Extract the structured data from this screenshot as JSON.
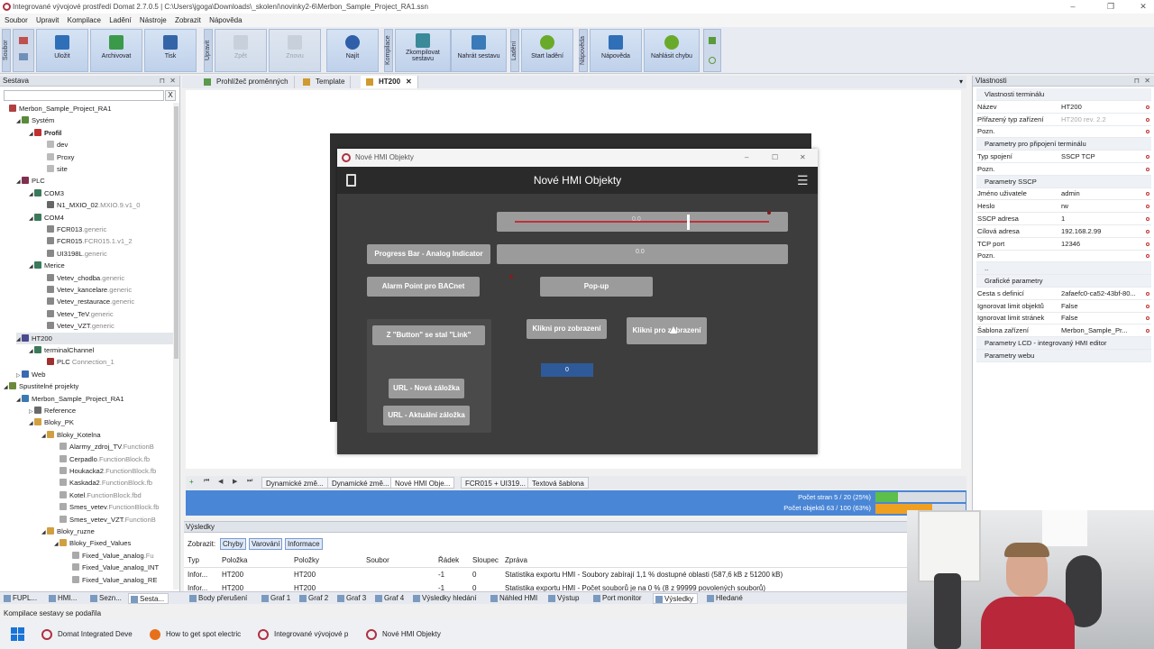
{
  "app": {
    "title": "Integrované vývojové prostředí Domat 2.7.0.5 | C:\\Users\\jgoga\\Downloads\\_skolení\\novinky2-6\\Merbon_Sample_Project_RA1.ssn",
    "menu": [
      "Soubor",
      "Upravit",
      "Kompilace",
      "Ladění",
      "Nástroje",
      "Zobrazit",
      "Nápověda"
    ],
    "window_controls": [
      "–",
      "❐",
      "✕"
    ]
  },
  "ribbon": {
    "groups": [
      "Soubor",
      "Upravit",
      "Kompilace",
      "Ladění",
      "Nápověda"
    ],
    "buttons": [
      "Uložit",
      "Archivovat",
      "Tisk",
      "Zpět",
      "Znovu",
      "Najít",
      "Zkompilovat sestavu",
      "Nahrát sestavu",
      "Start ladění",
      "Nápověda",
      "Nahlásit chybu"
    ]
  },
  "left_panel": {
    "title": "Sestava",
    "search_clear": "X",
    "tree": [
      {
        "text": "Merbon_Sample_Project_RA1",
        "gen": ""
      },
      {
        "text": "Systém",
        "gen": ""
      },
      {
        "text": "Profil",
        "gen": ""
      },
      {
        "text": "dev",
        "gen": ""
      },
      {
        "text": "Proxy",
        "gen": ""
      },
      {
        "text": "site",
        "gen": ""
      },
      {
        "text": "PLC",
        "gen": ""
      },
      {
        "text": "COM3",
        "gen": ""
      },
      {
        "text": "N1_MXIO_02",
        "gen": ".MXIO.9.v1_0"
      },
      {
        "text": "COM4",
        "gen": ""
      },
      {
        "text": "FCR013",
        "gen": ".generic"
      },
      {
        "text": "FCR015",
        "gen": ".FCR015.1.v1_2"
      },
      {
        "text": "UI3198L",
        "gen": ".generic"
      },
      {
        "text": "Merice",
        "gen": ""
      },
      {
        "text": "Vetev_chodba",
        "gen": ".generic"
      },
      {
        "text": "Vetev_kancelare",
        "gen": ".generic"
      },
      {
        "text": "Vetev_restaurace",
        "gen": ".generic"
      },
      {
        "text": "Vetev_TeV",
        "gen": ".generic"
      },
      {
        "text": "Vetev_VZT",
        "gen": ".generic"
      },
      {
        "text": "HT200",
        "gen": ""
      },
      {
        "text": "terminalChannel",
        "gen": ""
      },
      {
        "text": "PLC",
        "gen": " Connection_1"
      },
      {
        "text": "Web",
        "gen": ""
      },
      {
        "text": "Spustitelné projekty",
        "gen": ""
      },
      {
        "text": "Merbon_Sample_Project_RA1",
        "gen": ""
      },
      {
        "text": "Reference",
        "gen": ""
      },
      {
        "text": "Bloky_PK",
        "gen": ""
      },
      {
        "text": "Bloky_Kotelna",
        "gen": ""
      },
      {
        "text": "Alarmy_zdroj_TV",
        "gen": ".FunctionB"
      },
      {
        "text": "Cerpadlo",
        "gen": ".FunctionBlock.fb"
      },
      {
        "text": "Houkacka2",
        "gen": ".FunctionBlock.fb"
      },
      {
        "text": "Kaskada2",
        "gen": ".FunctionBlock.fb"
      },
      {
        "text": "Kotel",
        "gen": ".FunctionBlock.fbd"
      },
      {
        "text": "Smes_vetev",
        "gen": ".FunctionBlock.fb"
      },
      {
        "text": "Smes_vetev_VZT",
        "gen": ".FunctionB"
      },
      {
        "text": "Bloky_ruzne",
        "gen": ""
      },
      {
        "text": "Bloky_Fixed_Values",
        "gen": ""
      },
      {
        "text": "Fixed_Value_analog",
        "gen": ".Fu"
      },
      {
        "text": "Fixed_Value_analog_INT",
        "gen": ""
      },
      {
        "text": "Fixed_Value_analog_RE",
        "gen": ""
      }
    ]
  },
  "doc_tabs": [
    "Prohlížeč proměnných",
    "Template",
    "HT200"
  ],
  "hmi_window": {
    "title": "Nové HMI Objekty",
    "header": "Nové HMI Objekty",
    "slider_value": "0.0",
    "progress_value": "0.0",
    "numeric_value": "0",
    "buttons": {
      "progress_bar": "Progress Bar - Analog Indicator",
      "alarm_point": "Alarm Point pro BACnet",
      "popup": "Pop-up",
      "button_link": "Z \"Button\" se stal \"Link\"",
      "klikni1": "Klikni pro zobrazení",
      "klikni2": "Klikni pro zobrazení",
      "url_new": "URL - Nová záložka",
      "url_current": "URL - Aktuální záložka"
    }
  },
  "bottom_tabs": [
    "Dynamické změ...",
    "Dynamické změ...",
    "Nové HMI Obje...",
    "FCR015 + UI319...",
    "Textová šablona"
  ],
  "stats": {
    "pages": "Počet stran 5 / 20 (25%)",
    "objects": "Počet objektů 63 / 100 (63%)",
    "pages_pct": 25,
    "objects_pct": 63
  },
  "results": {
    "title": "Výsledky",
    "filter_label": "Zobrazit:",
    "filters": [
      "Chyby",
      "Varování",
      "Informace"
    ],
    "columns": [
      "Typ",
      "Položka",
      "Položky",
      "Soubor",
      "Řádek",
      "Sloupec",
      "Zpráva"
    ],
    "rows": [
      [
        "Infor...",
        "HT200",
        "HT200",
        "",
        "-1",
        "0",
        "Statistika exportu HMI - Soubory zabírají 1,1 % dostupné oblasti (587,6 kB z 51200 kB)"
      ],
      [
        "Infor...",
        "HT200",
        "HT200",
        "",
        "-1",
        "0",
        "Statistika exportu HMI - Počet souborů je na 0 % (8 z 99999 povolených souborů)"
      ]
    ]
  },
  "properties": {
    "title": "Vlastnosti",
    "rows": [
      {
        "k": "Vlastnosti terminálu",
        "v": "",
        "sec": true
      },
      {
        "k": "Název",
        "v": "HT200"
      },
      {
        "k": "Přiřazený typ zařízení",
        "v": "HT200 rev. 2.2",
        "gray": true
      },
      {
        "k": "Pozn.",
        "v": ""
      },
      {
        "k": "Parametry pro připojení terminálu",
        "v": "",
        "sec": true
      },
      {
        "k": "Typ spojení",
        "v": "SSCP TCP"
      },
      {
        "k": "Pozn.",
        "v": ""
      },
      {
        "k": "Parametry SSCP",
        "v": "",
        "sec": true
      },
      {
        "k": "Jméno uživatele",
        "v": "admin"
      },
      {
        "k": "Heslo",
        "v": "rw"
      },
      {
        "k": "SSCP adresa",
        "v": "1"
      },
      {
        "k": "Cílová adresa",
        "v": "192.168.2.99"
      },
      {
        "k": "TCP port",
        "v": "12346"
      },
      {
        "k": "Pozn.",
        "v": ""
      },
      {
        "k": "..",
        "v": "",
        "sec": true
      },
      {
        "k": "Grafické parametry",
        "v": "",
        "sec": true
      },
      {
        "k": "Cesta s definicí",
        "v": "2afaefc0-ca52-43bf-80..."
      },
      {
        "k": "Ignorovat limit objektů",
        "v": "False"
      },
      {
        "k": "Ignorovat limit stránek",
        "v": "False"
      },
      {
        "k": "Šablona zařízení",
        "v": "Merbon_Sample_Pr..."
      },
      {
        "k": "Parametry LCD - integrovaný HMI editor",
        "v": "",
        "sec": true
      },
      {
        "k": "Parametry webu",
        "v": "",
        "sec": true
      }
    ]
  },
  "bottom_bar": [
    "FUPL...",
    "HMI...",
    "Sezn...",
    "Sesta...",
    "Body přerušení",
    "Graf 1",
    "Graf 2",
    "Graf 3",
    "Graf 4",
    "Výsledky hledání",
    "Náhled HMI",
    "Výstup",
    "Port monitor",
    "Výsledky",
    "Hledané"
  ],
  "status": "Kompilace sestavy se podařila",
  "taskbar": [
    "Domat Integrated Deve",
    "How to get spot electric",
    "Integrované vývojové p",
    "Nové HMI Objekty"
  ],
  "colors": {
    "accent": "#4a86d6",
    "slider": "#c0303a",
    "hmi_bg": "#3d3d3d",
    "button": "#9b9b9b",
    "value_box": "#2f5a9a"
  }
}
